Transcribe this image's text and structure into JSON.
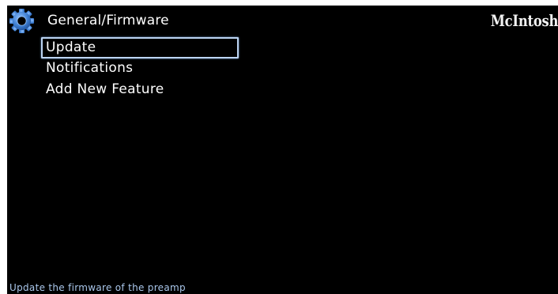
{
  "header": {
    "icon": "gear-icon",
    "title": "General/Firmware",
    "brand": "McIntosh"
  },
  "menu": {
    "items": [
      {
        "label": "Update",
        "selected": true
      },
      {
        "label": "Notifications",
        "selected": false
      },
      {
        "label": "Add New Feature",
        "selected": false
      }
    ]
  },
  "footer": {
    "hint": "Update the firmware of the preamp"
  },
  "colors": {
    "background": "#000000",
    "text": "#ffffff",
    "selection_border": "#bcd4f2",
    "hint_text": "#a9c6ea",
    "gear": "#4a86d6"
  }
}
